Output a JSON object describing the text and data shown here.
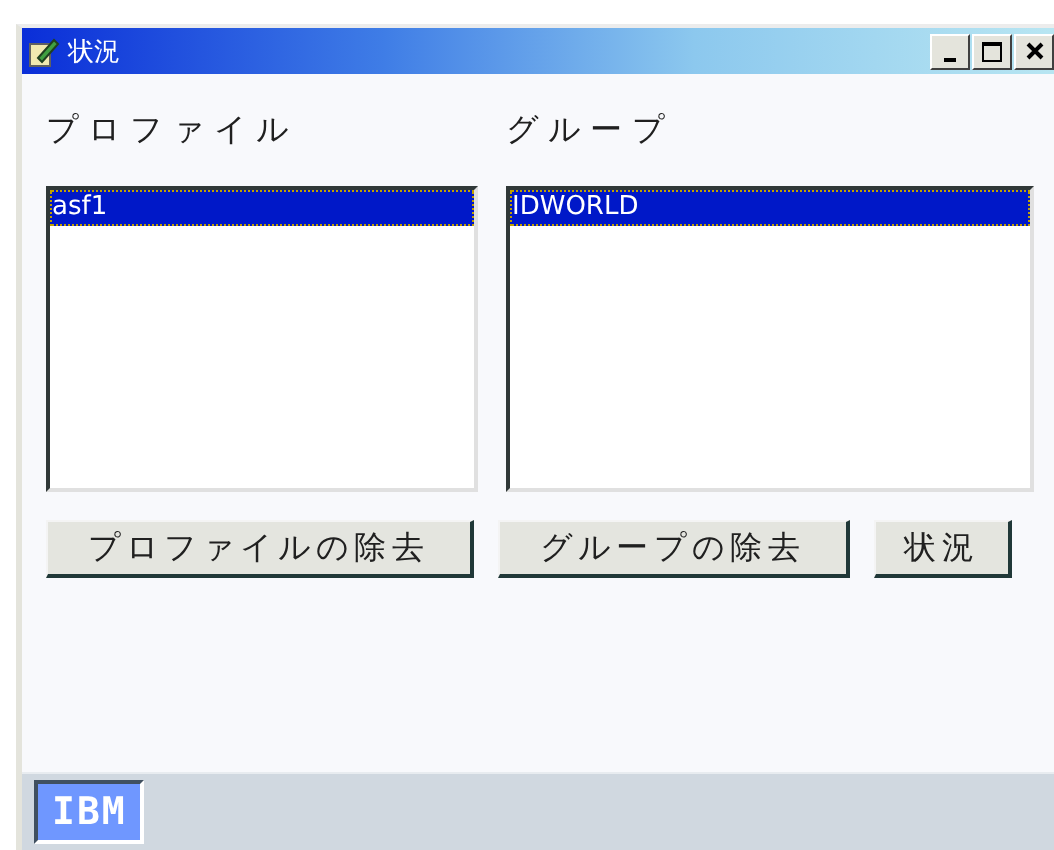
{
  "window": {
    "title": "状況"
  },
  "profiles": {
    "label": "プロファイル",
    "items": [
      {
        "text": "asf1",
        "selected": true
      }
    ]
  },
  "groups": {
    "label": "グループ",
    "items": [
      {
        "text": "IDWORLD",
        "selected": true
      }
    ]
  },
  "buttons": [
    "プロファイルの除去",
    "グループの除去",
    "状況"
  ],
  "status_bar": {
    "logo": "IBM"
  }
}
